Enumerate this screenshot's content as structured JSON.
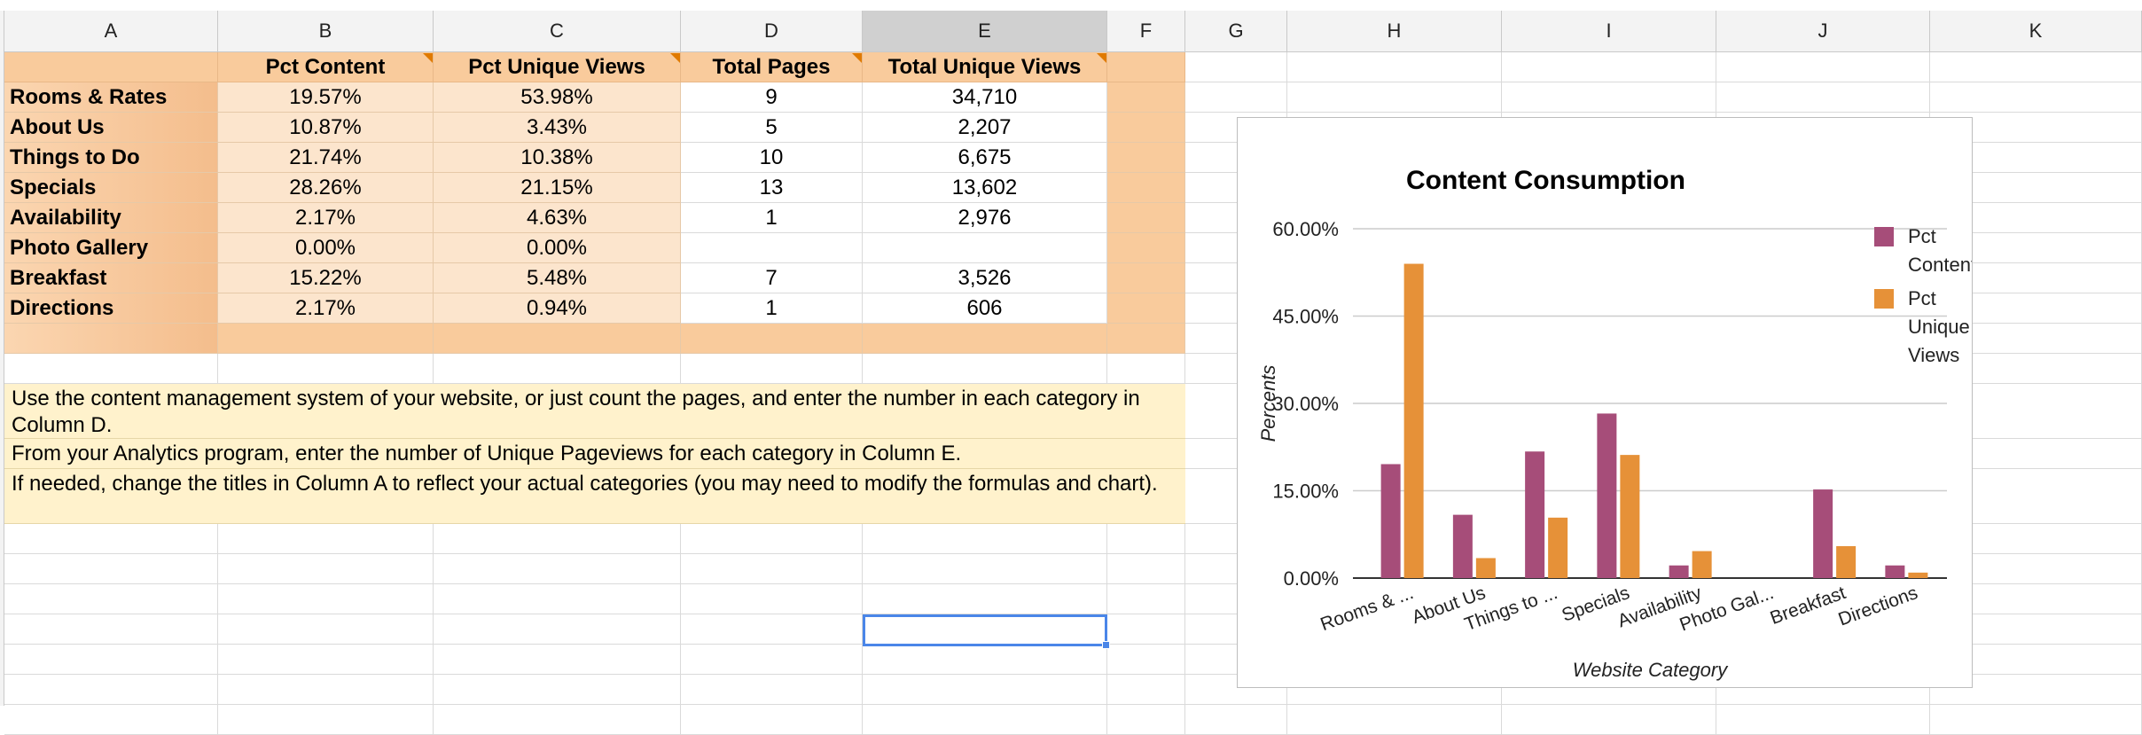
{
  "columns": [
    "A",
    "B",
    "C",
    "D",
    "E",
    "F",
    "G",
    "H",
    "I",
    "J",
    "K"
  ],
  "table": {
    "headers": [
      "",
      "Pct Content",
      "Pct Unique Views",
      "Total Pages",
      "Total Unique Views"
    ],
    "rows": [
      [
        "Rooms & Rates",
        "19.57%",
        "53.98%",
        "9",
        "34,710"
      ],
      [
        "About Us",
        "10.87%",
        "3.43%",
        "5",
        "2,207"
      ],
      [
        "Things to Do",
        "21.74%",
        "10.38%",
        "10",
        "6,675"
      ],
      [
        "Specials",
        "28.26%",
        "21.15%",
        "13",
        "13,602"
      ],
      [
        "Availability",
        "2.17%",
        "4.63%",
        "1",
        "2,976"
      ],
      [
        "Photo Gallery",
        "0.00%",
        "0.00%",
        "",
        ""
      ],
      [
        "Breakfast",
        "15.22%",
        "5.48%",
        "7",
        "3,526"
      ],
      [
        "Directions",
        "2.17%",
        "0.94%",
        "1",
        "606"
      ]
    ]
  },
  "notes": [
    "Use the content management system of your website, or just count the pages, and enter the number in each category in Column D.",
    "From your Analytics program, enter the number of Unique Pageviews for each category in Column E.",
    "If needed, change the titles in Column A to reflect your actual categories (you may need to modify the formulas and chart)."
  ],
  "colors": {
    "header_orange": "#f9cb9c",
    "label_orange": "#f6c596",
    "light_orange": "#fce5cd",
    "note_yellow": "#fff2cc",
    "selection_blue": "#4a86e8",
    "series_content": "#a64d79",
    "series_views": "#e69138"
  },
  "chart_data": {
    "type": "bar",
    "title": "Content Consumption",
    "xlabel": "Website Category",
    "ylabel": "Percents",
    "categories": [
      "Rooms & ...",
      "About Us",
      "Things to ...",
      "Specials",
      "Availability",
      "Photo Gal...",
      "Breakfast",
      "Directions"
    ],
    "series": [
      {
        "name": "Pct Content",
        "legend_lines": [
          "Pct",
          "Content"
        ],
        "values": [
          19.57,
          10.87,
          21.74,
          28.26,
          2.17,
          0.0,
          15.22,
          2.17
        ]
      },
      {
        "name": "Pct Unique Views",
        "legend_lines": [
          "Pct",
          "Unique",
          "Views"
        ],
        "values": [
          53.98,
          3.43,
          10.38,
          21.15,
          4.63,
          0.0,
          5.48,
          0.94
        ]
      }
    ],
    "ylim": [
      0,
      60
    ],
    "yticks": [
      0,
      15,
      30,
      45,
      60
    ],
    "ytick_labels": [
      "0.00%",
      "15.00%",
      "30.00%",
      "45.00%",
      "60.00%"
    ],
    "grid": true,
    "legend_position": "right"
  }
}
